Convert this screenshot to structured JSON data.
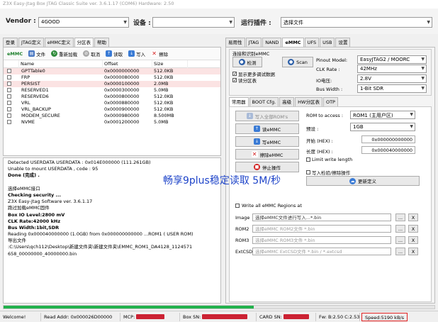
{
  "title": "Z3X Easy-Jtag Box JTAG Classic Suite ver. 3.6.1.17 (COM6) Hardware: 2.50",
  "top": {
    "vendor_label": "Vendor :",
    "vendor_value": "4GOOD",
    "device_label": "设备 :",
    "device_value": "",
    "plugin_label": "运行插件 :",
    "plugin_value": "选择文件"
  },
  "left_tabs": [
    "登录",
    "JTAG定义",
    "eMMC定义",
    "分区表",
    "帮助"
  ],
  "left_toolbar": {
    "emmc": "eMMC",
    "file": "文件",
    "reload": "重新加载",
    "cancel": "取消",
    "read": "读取",
    "write": "写入",
    "erase": "擦除"
  },
  "partition_table": {
    "columns": [
      "Name",
      "Offset",
      "Size"
    ],
    "rows": [
      {
        "name": "GPTTable0",
        "offset": "0x0000000000",
        "size": "512.0KB"
      },
      {
        "name": "FRP",
        "offset": "0x0000080000",
        "size": "512.0KB"
      },
      {
        "name": "PERSIST",
        "offset": "0x0000100000",
        "size": "2.0MB"
      },
      {
        "name": "RESERVED1",
        "offset": "0x0000300000",
        "size": "5.0MB"
      },
      {
        "name": "RESERVED6",
        "offset": "0x0000800000",
        "size": "512.0KB"
      },
      {
        "name": "VRL",
        "offset": "0x0000880000",
        "size": "512.0KB"
      },
      {
        "name": "VRL_BACKUP",
        "offset": "0x0000900000",
        "size": "512.0KB"
      },
      {
        "name": "MODEM_SECURE",
        "offset": "0x0000980000",
        "size": "8.500MB"
      },
      {
        "name": "NVME",
        "offset": "0x0001200000",
        "size": "5.0MB"
      }
    ]
  },
  "log": [
    "Detected USERDATA USERDATA : 0x014E000000 (111.261GB)",
    "Unable to mount USERDATA , code : 95",
    "Done (完成) .",
    "",
    "选择eMMC接口",
    "Checking security ...",
    "Z3X Easy-Jtag Software ver. 3.6.1.17",
    "跑过加载eMMC固件",
    "Box IO Level:2800 mV",
    "CLK Rate:42000 kHz",
    "Bus Width:1bit,SDR",
    "Reading 0x000040000000 (1.0GB) from 0x000000000000 ...ROM1 ( USER ROM)",
    "导出文件",
    ":C:\\Users\\qch112\\Desktop\\新建文件夹\\新建文件夹\\EMMC_ROM1_DA4128_1124571",
    "658_00000000_40000000.bin"
  ],
  "overlay_text": "畅享9plus稳定读取 5M/秒",
  "right_tabs": [
    "易用性",
    "JTAG",
    "NAND",
    "eMMC",
    "UFS",
    "USB",
    "设置"
  ],
  "right_top": {
    "group_title": "连接和识别eMMC",
    "detect": "检测",
    "scan": "Scan",
    "cb_show_full": "显示更多调试数据",
    "cb_partition": "读分区表",
    "pinout_label": "Pinout Model:",
    "pinout_value": "EasyJTAG2 / MOORC",
    "clk_label": "CLK Rate :",
    "clk_value": "42MHz",
    "io_label": "IO电压:",
    "io_value": "2.8V",
    "bus_label": "Bus Width :",
    "bus_value": "1-Bit SDR"
  },
  "sub_tabs": [
    "常用器",
    "BOOT Cfg.",
    "高级",
    "HW分区表",
    "OTP"
  ],
  "actions": {
    "write_all": "写入全部ROM's",
    "read": "读eMMC",
    "write": "写eMMC",
    "erase": "擦除eMMC",
    "stop": "停止操作"
  },
  "rom_opts": {
    "rom_access_label": "ROM to access :",
    "rom_access_value": "ROM1 (主用户区)",
    "preset_label": "预设 :",
    "preset_value": "1GB",
    "start_label": "开始 (HEX) :",
    "start_value": "0x000000000000",
    "length_label": "长度 (HEX) :",
    "length_value": "0x000040000000",
    "limit_label": "Limit write length",
    "write_check_label": "写入检验/擦除操作",
    "update_def": "更新定义"
  },
  "rom_files": {
    "write_all_label": "Write all eMMC Regions at",
    "rows": [
      {
        "label": "Image",
        "placeholder": "选择eMMC文件进行写入...*.bin"
      },
      {
        "label": "ROM2",
        "placeholder": "选择eMMC ROM2文件 *.bin"
      },
      {
        "label": "ROM3",
        "placeholder": "选择eMMC ROM3文件 *.bin"
      },
      {
        "label": "ExtCSD",
        "placeholder": "选择eMMC ExtCSD文件 *.bin / *.extcsd"
      }
    ],
    "browse": "...",
    "clear": "X"
  },
  "status": {
    "welcome": "Welcome!",
    "read_addr": "Read Addr: 0x000026D00000",
    "mcp": "MCP:",
    "box_sn": "Box SN:",
    "card_sn": "CARD SN:",
    "fw": "Fw: B:2.50 C:2.53",
    "speed": "Speed:5190 kB/s"
  },
  "progress": 0.58,
  "colors": {
    "pink_row": "#fbe3e3",
    "overlay": "#1e44c9",
    "progress": "#22b14c",
    "speed_border": "#e02020"
  }
}
